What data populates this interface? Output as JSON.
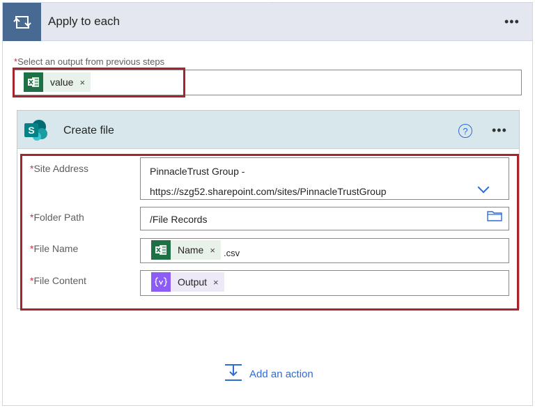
{
  "apply_to_each": {
    "title": "Apply to each",
    "menu_label": "•••",
    "select_label": "Select an output from previous steps",
    "required_mark": "*",
    "token": {
      "label": "value",
      "close": "×",
      "icon": "excel-icon"
    }
  },
  "create_file": {
    "title": "Create file",
    "help_label": "?",
    "menu_label": "•••",
    "icon": "sharepoint-icon",
    "fields": {
      "site_address": {
        "label": "Site Address",
        "value_line1": "PinnacleTrust Group -",
        "value_line2": "https://szg52.sharepoint.com/sites/PinnacleTrustGroup"
      },
      "folder_path": {
        "label": "Folder Path",
        "value": "/File Records"
      },
      "file_name": {
        "label": "File Name",
        "token": {
          "label": "Name",
          "close": "×",
          "icon": "excel-icon"
        },
        "suffix": ".csv"
      },
      "file_content": {
        "label": "File Content",
        "token": {
          "label": "Output",
          "close": "×",
          "icon": "expression-icon"
        }
      }
    }
  },
  "add_action": {
    "label": "Add an action"
  },
  "colors": {
    "header_blue": "#486991",
    "link_blue": "#2b6cd8",
    "required_red": "#c4314b",
    "highlight_red": "#a4262c",
    "excel_green": "#1e7145",
    "expression_purple": "#8b5cf6"
  }
}
